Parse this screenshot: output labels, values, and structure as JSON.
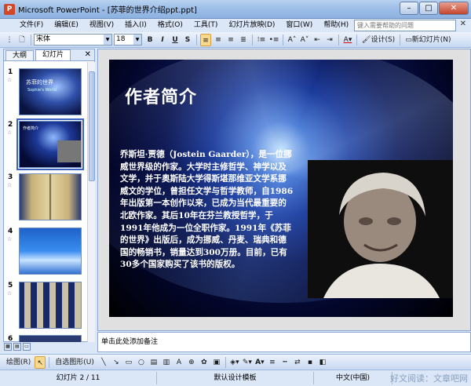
{
  "window": {
    "title": "Microsoft PowerPoint - [苏菲的世界介绍ppt.ppt]",
    "min": "–",
    "max": "□",
    "close": "✕"
  },
  "menu": {
    "items": [
      "文件(F)",
      "编辑(E)",
      "视图(V)",
      "插入(I)",
      "格式(O)",
      "工具(T)",
      "幻灯片放映(D)",
      "窗口(W)",
      "帮助(H)"
    ],
    "help_placeholder": "键入需要帮助的问题",
    "close": "✕"
  },
  "toolbar": {
    "font": "宋体",
    "size": "18",
    "bold": "B",
    "italic": "I",
    "underline": "U",
    "shadow": "S",
    "design_label": "设计(S)",
    "new_slide_label": "新幻灯片(N)"
  },
  "left_pane": {
    "tabs": [
      "大纲",
      "幻灯片"
    ],
    "active_tab": "幻灯片",
    "close": "✕",
    "slides": [
      {
        "num": "1",
        "title": "苏菲的世界",
        "subtitle": "Sophie's World"
      },
      {
        "num": "2",
        "title": "作者简介"
      },
      {
        "num": "3"
      },
      {
        "num": "4"
      },
      {
        "num": "5"
      },
      {
        "num": "6"
      }
    ],
    "selected": 2
  },
  "slide": {
    "title": "作者简介",
    "body": "乔斯坦·贾德（Jostein Gaarder），是一位挪威世界级的作家。大学时主修哲学、神学以及文学，并于奥斯陆大学得斯堪那维亚文学系挪威文的学位，曾担任文学与哲学教师，自1986年出版第一本创作以来，已成为当代最重要的北欧作家。其后10年在芬兰教授哲学，于1991年他成为一位全职作家。1991年《苏菲的世界》出版后，成为挪威、丹麦、瑞典和德国的畅销书，销量达到300万册。目前，已有30多个国家购买了该书的版权。"
  },
  "notes": {
    "placeholder": "单击此处添加备注"
  },
  "drawbar": {
    "draw_label": "绘图(R)",
    "autoshape_label": "自选图形(U)"
  },
  "status": {
    "slide": "幻灯片 2 / 11",
    "template": "默认设计模板",
    "lang": "中文(中国)"
  },
  "watermark": "好文阅读：文章吧网",
  "colors": {
    "accent": "#3a64c4",
    "titlebar": "#9cbde6",
    "slide_bg": "#03062a"
  }
}
